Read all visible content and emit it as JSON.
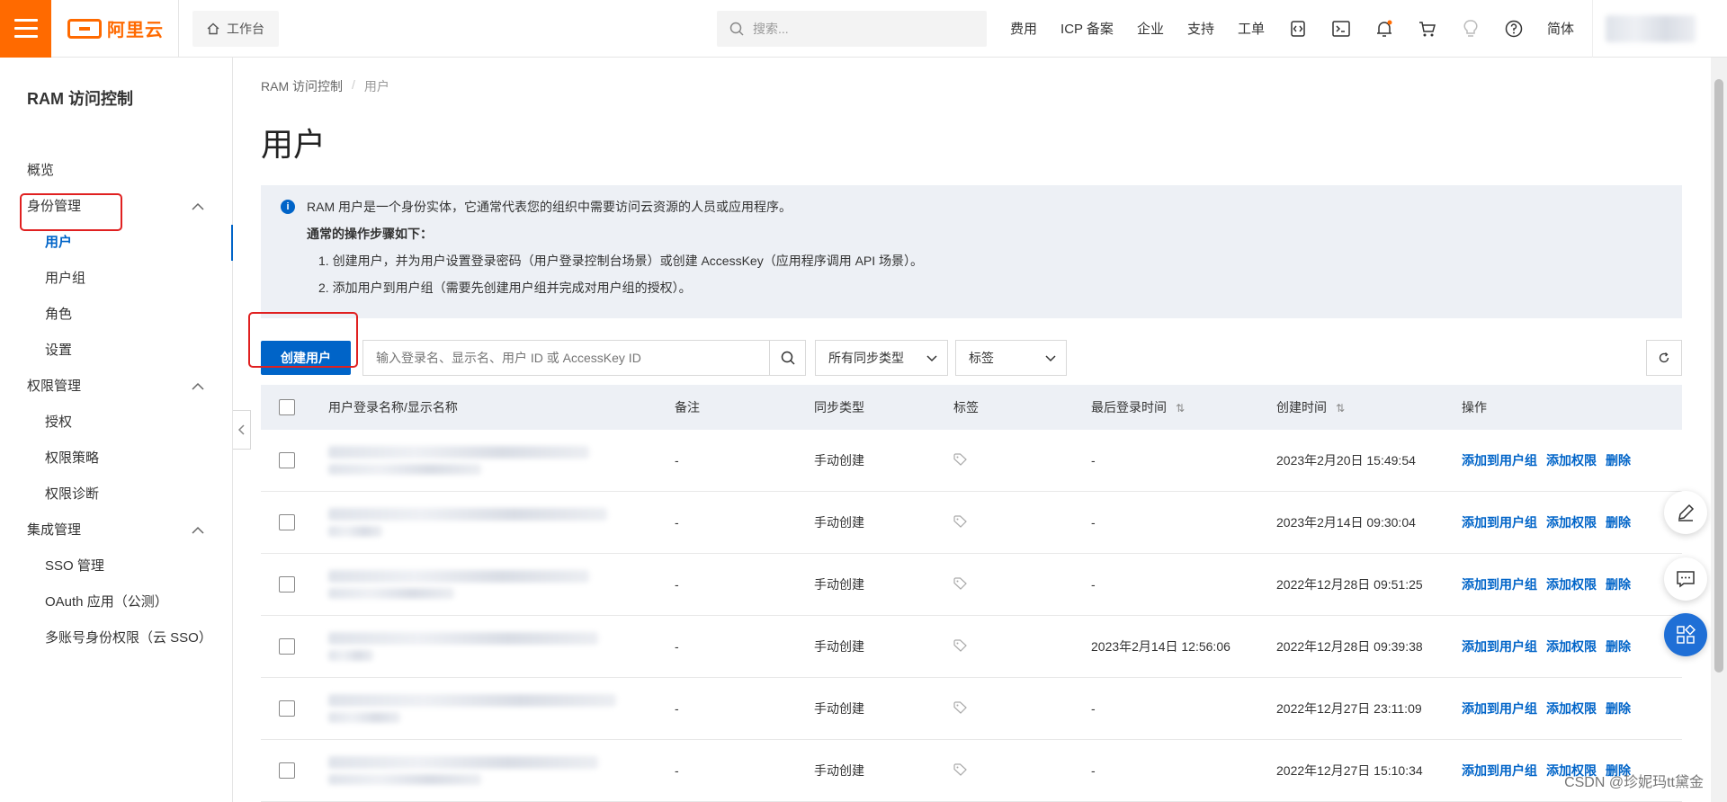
{
  "brand": {
    "name": "阿里云",
    "accent": "#ff6a00"
  },
  "header": {
    "workbench_label": "工作台",
    "search_placeholder": "搜索...",
    "links": [
      "费用",
      "ICP 备案",
      "企业",
      "支持",
      "工单"
    ],
    "language": "简体",
    "icons": [
      "code-icon",
      "terminal-icon",
      "bell-icon",
      "cart-icon",
      "bulb-icon",
      "help-icon"
    ]
  },
  "sidebar": {
    "title": "RAM 访问控制",
    "overview": "概览",
    "groups": [
      {
        "label": "身份管理",
        "items": [
          "用户",
          "用户组",
          "角色",
          "设置"
        ]
      },
      {
        "label": "权限管理",
        "items": [
          "授权",
          "权限策略",
          "权限诊断"
        ]
      },
      {
        "label": "集成管理",
        "items": [
          "SSO 管理",
          "OAuth 应用（公测）",
          "多账号身份权限（云 SSO）"
        ]
      }
    ]
  },
  "breadcrumb": {
    "root": "RAM 访问控制",
    "separator": "/",
    "current": "用户"
  },
  "page_title": "用户",
  "notice": {
    "intro": "RAM 用户是一个身份实体，它通常代表您的组织中需要访问云资源的人员或应用程序。",
    "heading": "通常的操作步骤如下：",
    "step1": "1. 创建用户，并为用户设置登录密码（用户登录控制台场景）或创建 AccessKey（应用程序调用 API 场景）。",
    "step2": "2. 添加用户到用户组（需要先创建用户组并完成对用户组的授权）。"
  },
  "toolbar": {
    "create_button": "创建用户",
    "search_placeholder": "输入登录名、显示名、用户 ID 或 AccessKey ID",
    "sync_type_select": "所有同步类型",
    "tag_select": "标签"
  },
  "table": {
    "headers": {
      "name": "用户登录名称/显示名称",
      "remark": "备注",
      "sync": "同步类型",
      "tag": "标签",
      "last_login": "最后登录时间",
      "created": "创建时间",
      "ops": "操作"
    },
    "rows": [
      {
        "remark": "-",
        "sync": "手动创建",
        "last_login": "-",
        "created": "2023年2月20日 15:49:54"
      },
      {
        "remark": "-",
        "sync": "手动创建",
        "last_login": "-",
        "created": "2023年2月14日 09:30:04"
      },
      {
        "remark": "-",
        "sync": "手动创建",
        "last_login": "-",
        "created": "2022年12月28日 09:51:25"
      },
      {
        "remark": "-",
        "sync": "手动创建",
        "last_login": "2023年2月14日 12:56:06",
        "created": "2022年12月28日 09:39:38"
      },
      {
        "remark": "-",
        "sync": "手动创建",
        "last_login": "-",
        "created": "2022年12月27日 23:11:09"
      },
      {
        "remark": "-",
        "sync": "手动创建",
        "last_login": "-",
        "created": "2022年12月27日 15:10:34"
      }
    ],
    "ops": {
      "add_to_group": "添加到用户组",
      "add_permission": "添加权限",
      "delete": "删除"
    }
  },
  "watermark": "CSDN @珍妮玛tt黛金",
  "colors": {
    "primary": "#0064c8",
    "highlight_box": "#e02020",
    "notice_bg": "#edf0f5"
  }
}
